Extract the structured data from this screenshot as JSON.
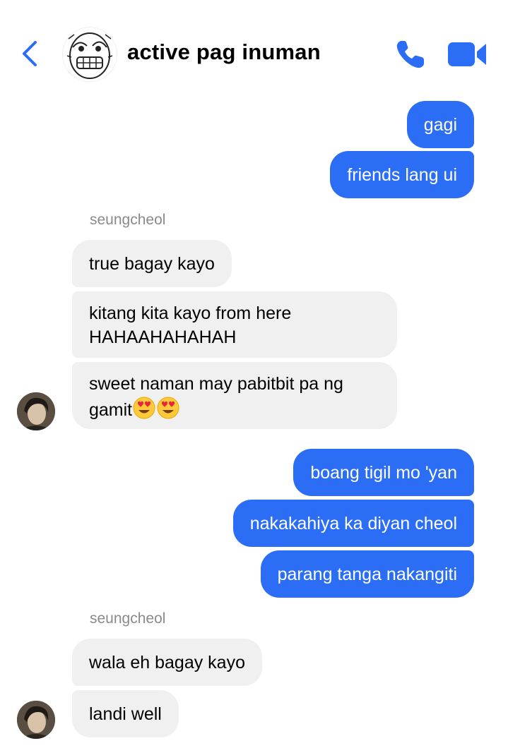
{
  "header": {
    "title": "active pag inuman",
    "icons": {
      "back": "chevron-left-icon",
      "call": "phone-icon",
      "video": "video-camera-icon"
    },
    "accent_color": "#2b6ef5"
  },
  "messages": [
    {
      "from": "me",
      "text": "gagi"
    },
    {
      "from": "me",
      "text": "friends lang ui"
    },
    {
      "sender_label": "seungcheol"
    },
    {
      "from": "seungcheol",
      "text": "true bagay kayo"
    },
    {
      "from": "seungcheol",
      "line1": "kitang kita kayo from here",
      "line2": "HAHAAHAHAHAH"
    },
    {
      "from": "seungcheol",
      "line1": "sweet naman may pabitbit pa ng",
      "line2": "gamit",
      "emoji": "heart-eyes-emoji"
    },
    {
      "from": "me",
      "text": "boang tigil mo 'yan"
    },
    {
      "from": "me",
      "text": "nakakahiya ka diyan cheol"
    },
    {
      "from": "me",
      "text": "parang tanga nakangiti"
    },
    {
      "sender_label": "seungcheol"
    },
    {
      "from": "seungcheol",
      "text": "wala eh bagay kayo"
    },
    {
      "from": "seungcheol",
      "text": "landi well"
    }
  ],
  "colors": {
    "outgoing_bubble": "#2b6ef5",
    "incoming_bubble": "#f0f0f0",
    "sender_label": "#8a8a8a"
  }
}
